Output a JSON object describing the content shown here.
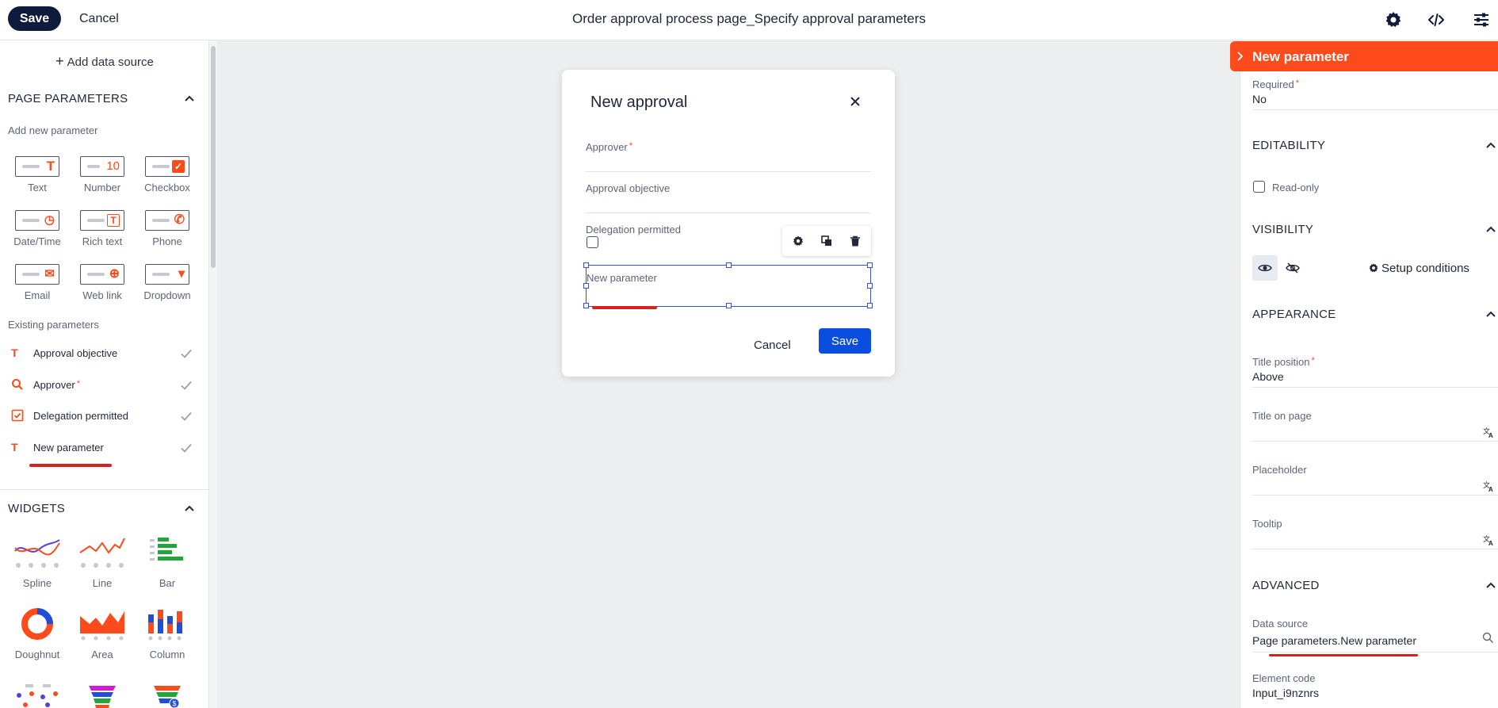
{
  "topbar": {
    "save_label": "Save",
    "cancel_label": "Cancel",
    "title": "Order approval process page_Specify approval parameters"
  },
  "left": {
    "add_data_source": "Add data source",
    "page_parameters_title": "PAGE PARAMETERS",
    "add_new_parameter": "Add new parameter",
    "param_types": [
      {
        "label": "Text",
        "icon": "text-type-icon",
        "glyph": "T"
      },
      {
        "label": "Number",
        "icon": "number-type-icon",
        "glyph": "10"
      },
      {
        "label": "Checkbox",
        "icon": "checkbox-type-icon",
        "glyph": "✓"
      },
      {
        "label": "Date/Time",
        "icon": "datetime-type-icon",
        "glyph": "◷"
      },
      {
        "label": "Rich text",
        "icon": "richtext-type-icon",
        "glyph": "T"
      },
      {
        "label": "Phone",
        "icon": "phone-type-icon",
        "glyph": "✆"
      },
      {
        "label": "Email",
        "icon": "email-type-icon",
        "glyph": "✉"
      },
      {
        "label": "Web link",
        "icon": "weblink-type-icon",
        "glyph": "⊕"
      },
      {
        "label": "Dropdown",
        "icon": "dropdown-type-icon",
        "glyph": "▾"
      }
    ],
    "existing_parameters_title": "Existing parameters",
    "existing": [
      {
        "label": "Approval objective",
        "icon": "text-type-icon",
        "required": false
      },
      {
        "label": "Approver",
        "icon": "search-icon",
        "required": true
      },
      {
        "label": "Delegation permitted",
        "icon": "checkbox-type-icon",
        "required": false
      },
      {
        "label": "New parameter",
        "icon": "text-type-icon",
        "required": false
      }
    ],
    "required_mark": "*",
    "widgets_title": "WIDGETS",
    "widgets": [
      {
        "label": "Spline"
      },
      {
        "label": "Line"
      },
      {
        "label": "Bar"
      },
      {
        "label": "Doughnut"
      },
      {
        "label": "Area"
      },
      {
        "label": "Column"
      }
    ]
  },
  "dialog": {
    "title": "New approval",
    "fields": {
      "approver": "Approver",
      "approval_objective": "Approval objective",
      "delegation_permitted": "Delegation permitted",
      "new_parameter": "New parameter"
    },
    "required_mark": "*",
    "cancel_label": "Cancel",
    "save_label": "Save"
  },
  "right": {
    "header_title": "New parameter",
    "required_label": "Required",
    "required_value": "No",
    "required_mark": "*",
    "editability_title": "EDITABILITY",
    "readonly_label": "Read-only",
    "visibility_title": "VISIBILITY",
    "setup_conditions": "Setup conditions",
    "appearance_title": "APPEARANCE",
    "title_position_label": "Title position",
    "title_position_value": "Above",
    "title_on_page_label": "Title on page",
    "placeholder_label": "Placeholder",
    "tooltip_label": "Tooltip",
    "advanced_title": "ADVANCED",
    "data_source_label": "Data source",
    "data_source_value": "Page parameters.New parameter",
    "element_code_label": "Element code",
    "element_code_value": "Input_i9nznrs"
  },
  "colors": {
    "accent_orange": "#ff4a1c",
    "primary_blue": "#0b4dde",
    "dark_navy": "#0f1b3d",
    "selection_blue": "#3e52b5",
    "annotation_red": "#d8201f"
  }
}
